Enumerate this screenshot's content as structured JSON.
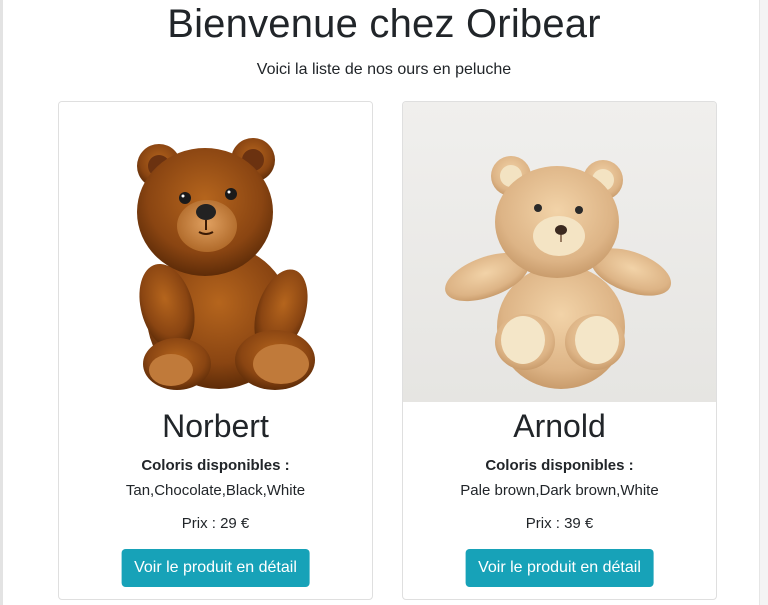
{
  "header": {
    "title": "Bienvenue chez Oribear",
    "subtitle": "Voici la liste de nos ours en peluche"
  },
  "products": [
    {
      "name": "Norbert",
      "colors_label": "Coloris disponibles :",
      "colors": "Tan,Chocolate,Black,White",
      "price": "Prix : 29 €",
      "button_label": "Voir le produit en détail",
      "image_icon": "brown-teddy-bear-image"
    },
    {
      "name": "Arnold",
      "colors_label": "Coloris disponibles :",
      "colors": "Pale brown,Dark brown,White",
      "price": "Prix : 39 €",
      "button_label": "Voir le produit en détail",
      "image_icon": "beige-teddy-bear-image"
    }
  ],
  "theme": {
    "button_color": "#17a2b8",
    "text_color": "#212529"
  }
}
